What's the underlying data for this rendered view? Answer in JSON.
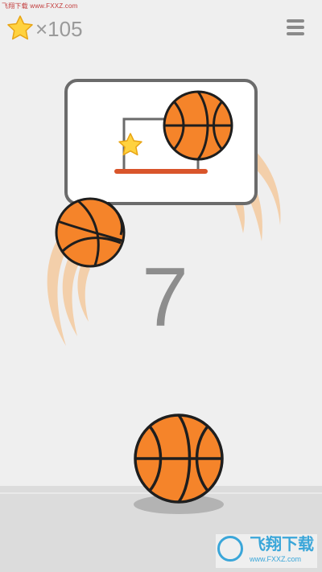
{
  "watermark": {
    "top_text": "飞翔下载 www.FXXZ.com",
    "logo_text": "飞翔下载",
    "logo_url": "www.FXXZ.com"
  },
  "hud": {
    "star_icon": "star-icon",
    "star_count": "×105",
    "menu_icon": "hamburger-menu-icon"
  },
  "game": {
    "score": "7"
  },
  "colors": {
    "background": "#efefef",
    "ball_orange": "#f5842a",
    "ball_seam": "#1e1e1e",
    "rim": "#d9552b",
    "trail": "#f4c89a",
    "star": "#ffd23f",
    "board_border": "#6b6b6b"
  }
}
